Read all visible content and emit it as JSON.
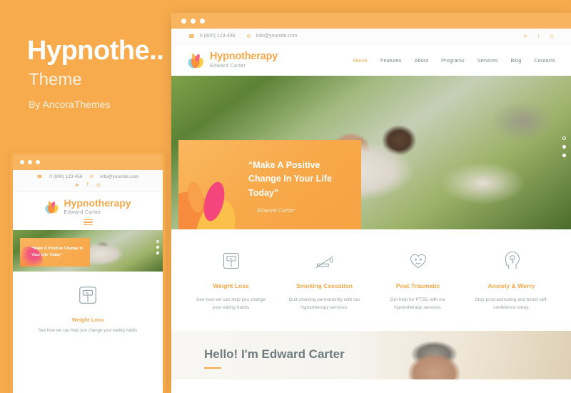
{
  "promo": {
    "title": "Hypnothe..",
    "subtitle": "Theme",
    "author": "By AncoraThemes",
    "bg_color": "#f7ab4d"
  },
  "site": {
    "topbar": {
      "phone": "0 (800) 123-456",
      "email": "info@yoursite.com",
      "phone_icon": "phone-icon",
      "email_icon": "envelope-icon",
      "social": [
        {
          "name": "twitter-icon",
          "glyph": "🐦"
        },
        {
          "name": "facebook-icon",
          "glyph": "f"
        },
        {
          "name": "instagram-icon",
          "glyph": "◎"
        }
      ]
    },
    "logo": {
      "name": "Hypnotherapy",
      "tagline": "Edward Carter",
      "icon": "lotus-flower-icon",
      "accent_color": "#f6a94b"
    },
    "menu": [
      {
        "label": "Home",
        "active": true
      },
      {
        "label": "Features",
        "active": false
      },
      {
        "label": "About",
        "active": false
      },
      {
        "label": "Programs",
        "active": false
      },
      {
        "label": "Services",
        "active": false
      },
      {
        "label": "Blog",
        "active": false
      },
      {
        "label": "Contacts",
        "active": false
      }
    ],
    "hero": {
      "quote": "“Make A Positive Change In Your Life Today”",
      "signature": "Edward Carter",
      "image_alt": "smiling woman relaxing outdoors in a garden hammock",
      "slider_dots": 3,
      "active_dot": 0
    },
    "services": [
      {
        "title": "Weight Loss",
        "desc": "See how we can help you change your eating habits",
        "icon": "weight-scale-icon"
      },
      {
        "title": "Smoking Cessation",
        "desc": "Quit smoking permanently with our hypnotherapy services.",
        "icon": "no-smoking-icon"
      },
      {
        "title": "Post-Traumatic",
        "desc": "Get help for PTSD with our hypnotherapy services.",
        "icon": "heart-face-icon"
      },
      {
        "title": "Anxiety & Worry",
        "desc": "Stop procrastinating and boost self-confidence today.",
        "icon": "head-key-icon"
      }
    ],
    "about": {
      "heading": "Hello! I'm Edward Carter",
      "image_alt": "portrait of grey haired man"
    }
  },
  "mobile": {
    "hero_quote": "“Make A Positive Change In Your Life Today”",
    "menu_icon": "hamburger-menu-icon"
  }
}
